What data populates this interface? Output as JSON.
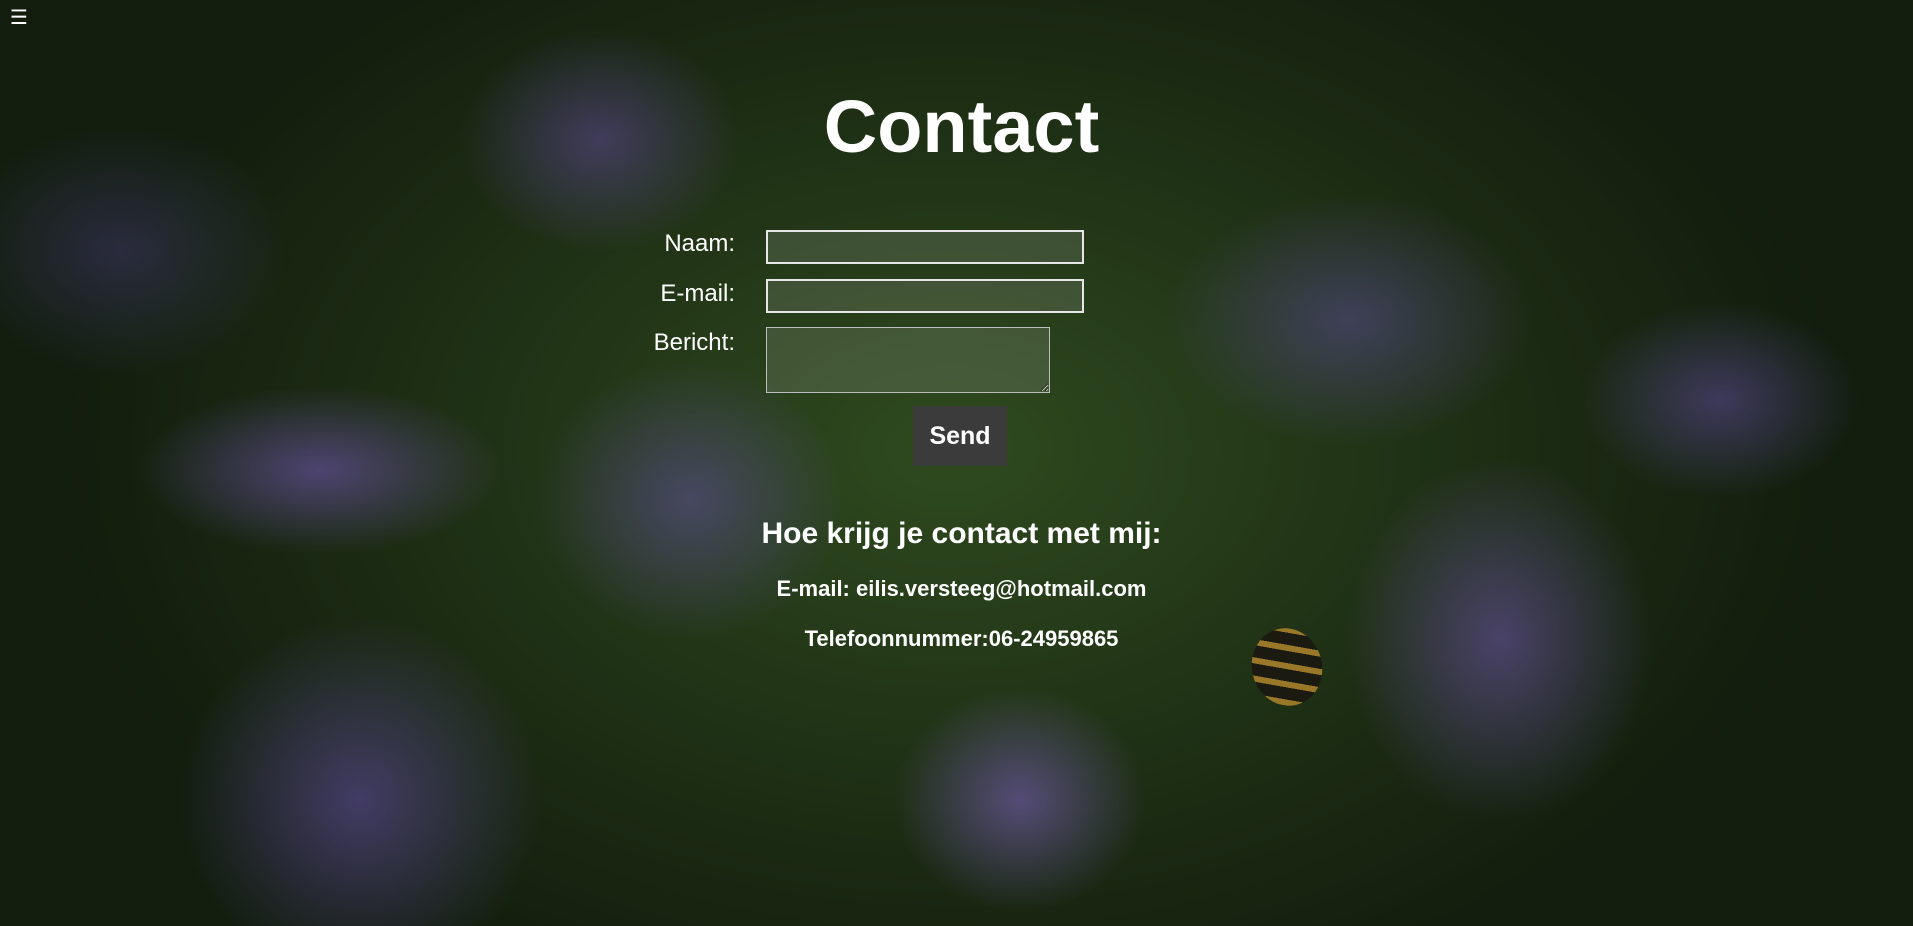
{
  "nav": {
    "menu_icon": "☰",
    "icon_name": "hamburger-menu-icon"
  },
  "page": {
    "title": "Contact"
  },
  "form": {
    "name_label": "Naam:",
    "name_value": "",
    "email_label": "E-mail:",
    "email_value": "",
    "message_label": "Bericht:",
    "message_value": "",
    "send_label": "Send"
  },
  "contact_info": {
    "heading": "Hoe krijg je contact met mij:",
    "email_line": "E-mail: eilis.versteeg@hotmail.com",
    "phone_line": "Telefoonnummer:06-24959865"
  },
  "colors": {
    "text": "#ffffff",
    "button_bg": "#3b3b3b",
    "input_border": "#e6e6e6"
  }
}
